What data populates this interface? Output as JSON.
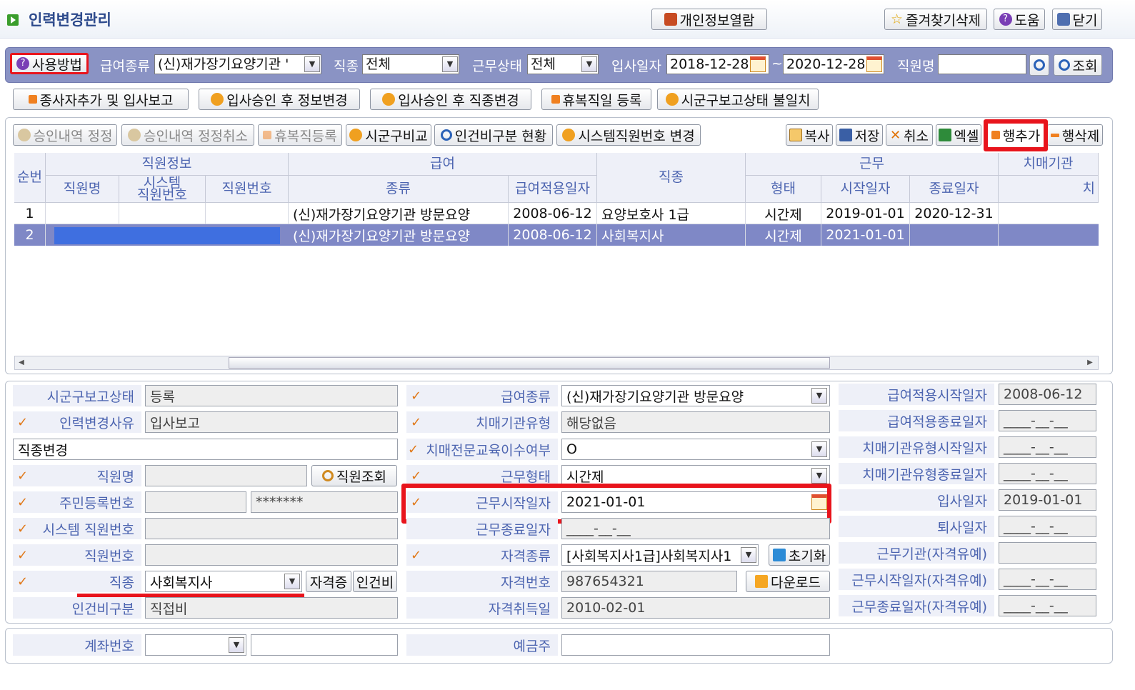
{
  "app": {
    "title": "인력변경관리"
  },
  "top_buttons": {
    "privacy": "개인정보열람",
    "fav_delete": "즐겨찾기삭제",
    "help": "도움",
    "close": "닫기"
  },
  "filter": {
    "usage": "사용방법",
    "pay_label": "급여종류",
    "pay_value": "(신)재가장기요양기관 '",
    "job_label": "직종",
    "job_value": "전체",
    "status_label": "근무상태",
    "status_value": "전체",
    "hire_label": "입사일자",
    "hire_from": "2018-12-28",
    "tilde": "~",
    "hire_to": "2020-12-28",
    "name_label": "직원명",
    "name_value": "",
    "search": "조회"
  },
  "actions1": [
    "종사자추가 및 입사보고",
    "입사승인 후 정보변경",
    "입사승인 후 직종변경",
    "휴복직일 등록",
    "시군구보고상태 불일치"
  ],
  "actions2": {
    "approve_fix": "승인내역 정정",
    "approve_cancel": "승인내역 정정취소",
    "leave_reg": "휴복직등록",
    "compare": "시군구비교",
    "labor": "인건비구분 현황",
    "sysno": "시스템직원번호 변경",
    "copy": "복사",
    "save": "저장",
    "cancel": "취소",
    "excel": "엑셀",
    "add_row": "행추가",
    "del_row": "행삭제"
  },
  "grid": {
    "group_headers": {
      "staff": "직원정보",
      "pay": "급여",
      "job": "직종",
      "work": "근무",
      "dementia": "치매기관"
    },
    "headers": {
      "seq": "순번",
      "name": "직원명",
      "sysno": "시스템\n직원번호",
      "empno": "직원번호",
      "pay_type": "종류",
      "pay_date": "급여적용일자",
      "work_type": "형태",
      "start": "시작일자",
      "end": "종료일자",
      "dem": "치"
    },
    "rows": [
      {
        "seq": "1",
        "pay_type": "(신)재가장기요양기관 방문요양",
        "pay_date": "2008-06-12",
        "job": "요양보호사 1급",
        "work_type": "시간제",
        "start": "2019-01-01",
        "end": "2020-12-31"
      },
      {
        "seq": "2",
        "pay_type": "(신)재가장기요양기관 방문요양",
        "pay_date": "2008-06-12",
        "job": "사회복지사",
        "work_type": "시간제",
        "start": "2021-01-01",
        "end": ""
      }
    ]
  },
  "form": {
    "report_status_label": "시군구보고상태",
    "report_status": "등록",
    "reason_label": "인력변경사유",
    "reason": "입사보고",
    "reason_detail": "직종변경",
    "name_label": "직원명",
    "name": "",
    "name_search": "직원조회",
    "rrn_label": "주민등록번호",
    "rrn_front": "",
    "rrn_back": "*******",
    "sysno_label": "시스템 직원번호",
    "sysno": "",
    "empno_label": "직원번호",
    "empno": "",
    "job_label": "직종",
    "job": "사회복지사",
    "cert_btn": "자격증",
    "labor_btn": "인건비",
    "labor_type_label": "인건비구분",
    "labor_type": "직접비",
    "pay_type_label": "급여종류",
    "pay_type": "(신)재가장기요양기관 방문요양",
    "dem_type_label": "치매기관유형",
    "dem_type": "해당없음",
    "dem_edu_label": "치매전문교육이수여부",
    "dem_edu": "O",
    "work_type_label": "근무형태",
    "work_type": "시간제",
    "work_start_label": "근무시작일자",
    "work_start": "2021-01-01",
    "work_end_label": "근무종료일자",
    "work_end": "____-__-__",
    "cert_type_label": "자격종류",
    "cert_type": "[사회복지사1급]사회복지사1",
    "reset": "초기화",
    "cert_no_label": "자격번호",
    "cert_no": "987654321",
    "download": "다운로드",
    "cert_date_label": "자격취득일",
    "cert_date": "2010-02-01",
    "pay_start_label": "급여적용시작일자",
    "pay_start": "2008-06-12",
    "pay_end_label": "급여적용종료일자",
    "pay_end": "____-__-__",
    "dem_start_label": "치매기관유형시작일자",
    "dem_start": "____-__-__",
    "dem_end_label": "치매기관유형종료일자",
    "dem_end": "____-__-__",
    "hire_label": "입사일자",
    "hire": "2019-01-01",
    "retire_label": "퇴사일자",
    "retire": "____-__-__",
    "inst_label": "근무기관(자격유예)",
    "inst": "",
    "ws_label": "근무시작일자(자격유예)",
    "ws": "____-__-__",
    "we_label": "근무종료일자(자격유예)",
    "we": "____-__-__"
  },
  "bank": {
    "account_label": "계좌번호",
    "holder_label": "예금주"
  },
  "colors": {
    "accent": "#8a93c4",
    "highlight": "#e8141c",
    "selected_row": "#7f88c6"
  }
}
